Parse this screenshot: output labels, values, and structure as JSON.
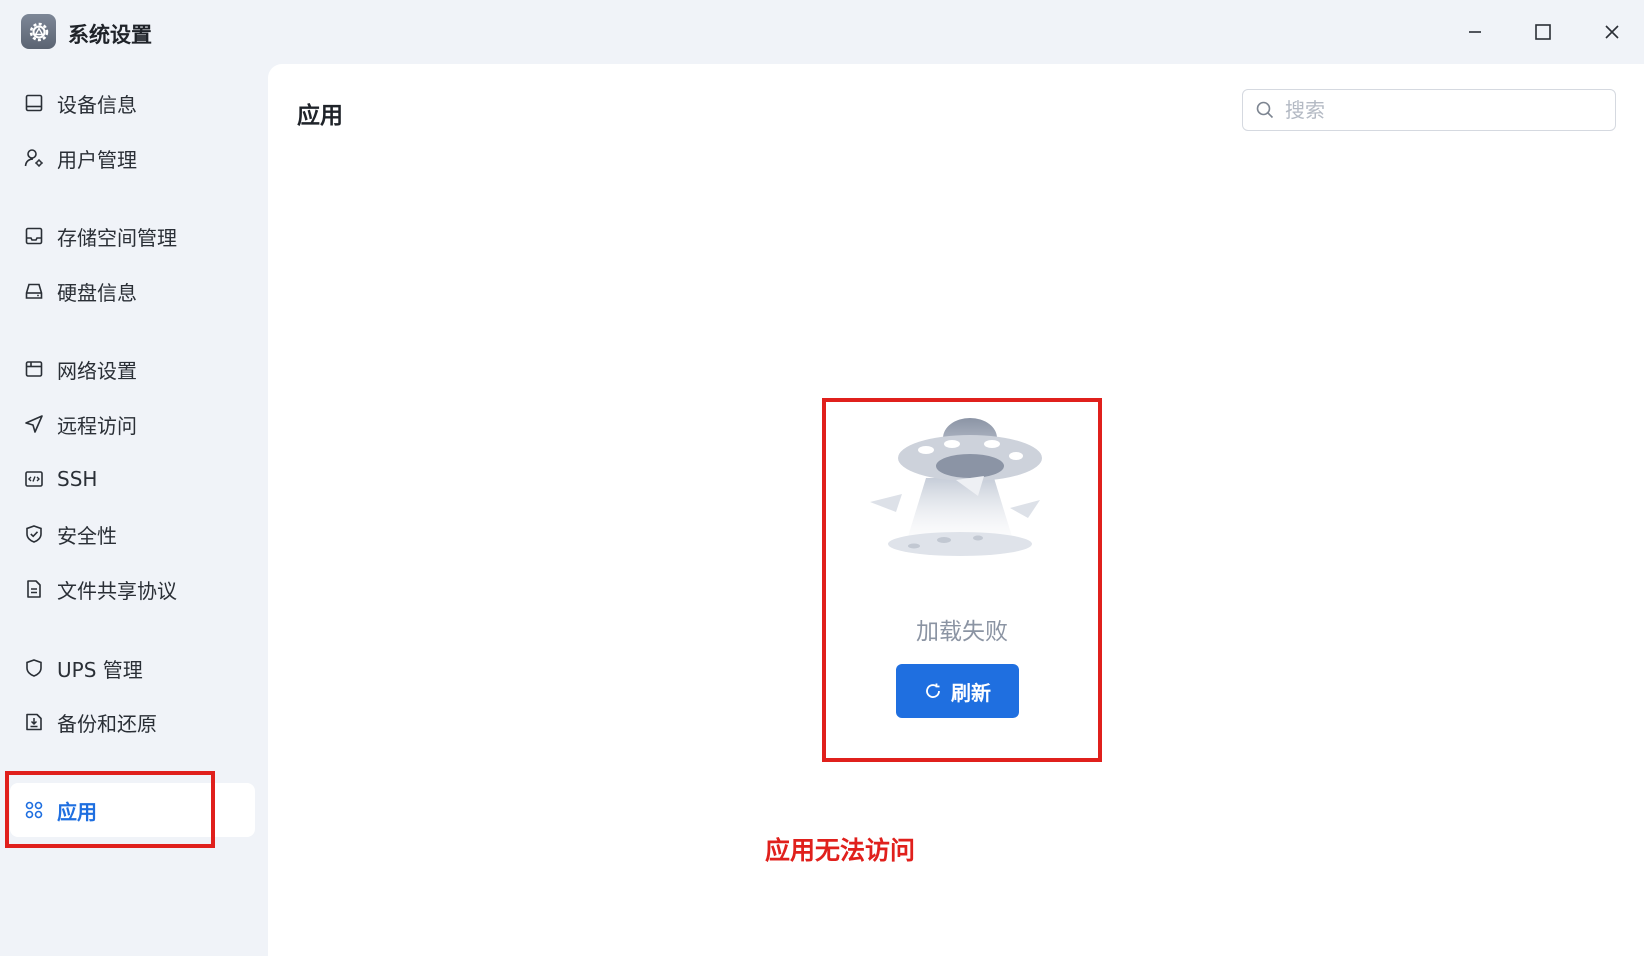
{
  "window": {
    "title": "系统设置",
    "app_icon": "gear-icon",
    "controls": [
      "minimize-icon",
      "maximize-icon",
      "close-icon"
    ]
  },
  "sidebar": {
    "items": [
      {
        "label": "设备信息",
        "icon": "device-icon"
      },
      {
        "label": "用户管理",
        "icon": "user-settings-icon"
      },
      {
        "label": "存储空间管理",
        "icon": "storage-icon"
      },
      {
        "label": "硬盘信息",
        "icon": "harddisk-icon"
      },
      {
        "label": "网络设置",
        "icon": "network-icon"
      },
      {
        "label": "远程访问",
        "icon": "send-icon"
      },
      {
        "label": "SSH",
        "icon": "code-icon"
      },
      {
        "label": "安全性",
        "icon": "shield-check-icon"
      },
      {
        "label": "文件共享协议",
        "icon": "document-icon"
      },
      {
        "label": "UPS 管理",
        "icon": "shield-icon"
      },
      {
        "label": "备份和还原",
        "icon": "backup-icon"
      },
      {
        "label": "应用",
        "icon": "apps-icon",
        "active": true
      }
    ]
  },
  "main": {
    "title": "应用",
    "search": {
      "placeholder": "搜索",
      "value": ""
    },
    "error": {
      "message": "加载失败",
      "illustration": "ufo-illustration"
    },
    "refresh_label": "刷新"
  },
  "annotation": {
    "text": "应用无法访问",
    "color": "#e0201c"
  },
  "colors": {
    "accent": "#1f6fe0",
    "highlight": "#e0201c",
    "sidebar_bg": "#f0f3f8"
  }
}
